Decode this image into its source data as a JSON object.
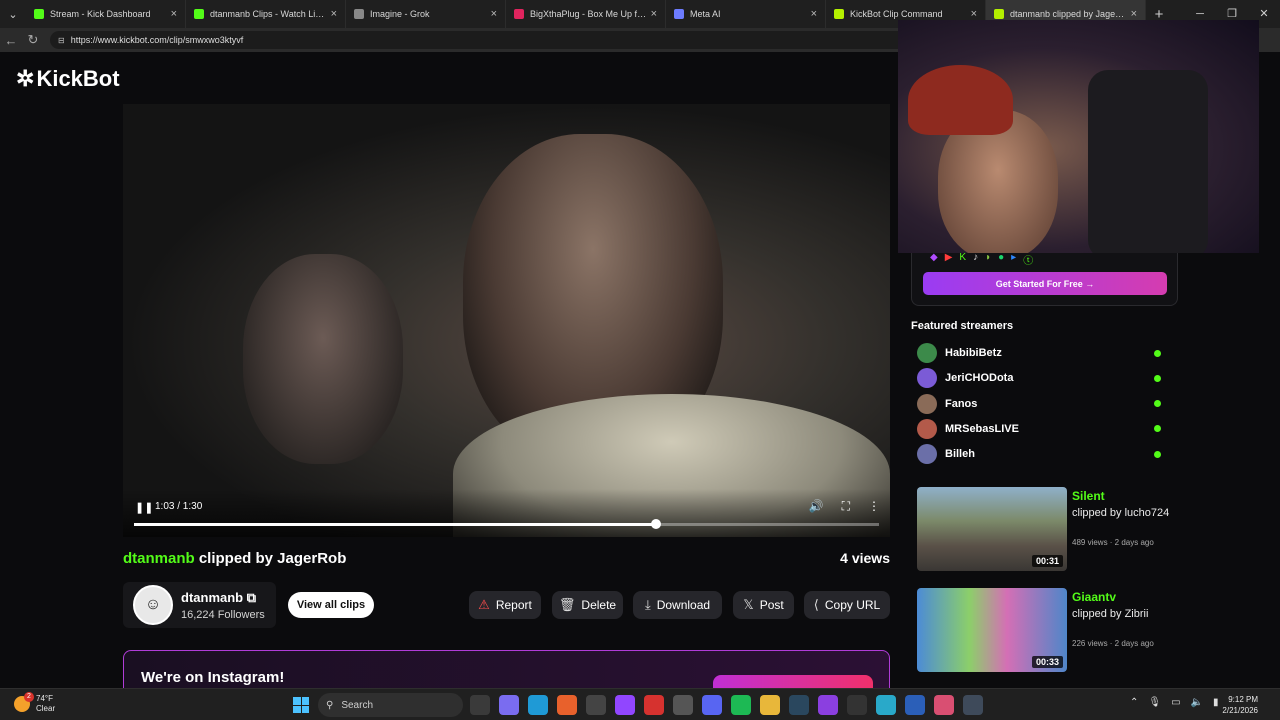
{
  "browser": {
    "tabs": [
      {
        "title": "Stream - Kick Dashboard",
        "color": "#53fc18",
        "active": false
      },
      {
        "title": "dtanmanb Clips - Watch Live on K",
        "color": "#53fc18",
        "active": false
      },
      {
        "title": "Imagine - Grok",
        "color": "#888888",
        "active": false
      },
      {
        "title": "BigXthaPlug - Box Me Up feat. Jel",
        "color": "#e0245e",
        "active": false
      },
      {
        "title": "Meta AI",
        "color": "#6d7cff",
        "active": false
      },
      {
        "title": "KickBot Clip Command",
        "color": "#b4f000",
        "active": false
      },
      {
        "title": "dtanmanb clipped by JagerRo",
        "color": "#b4f000",
        "active": true
      }
    ],
    "url": "https://www.kickbot.com/clip/smwxwo3ktyvf"
  },
  "site": {
    "logo_text": "KickBot"
  },
  "player": {
    "time": "1:03 / 1:30",
    "progress": 0.7
  },
  "clip": {
    "streamer": "dtanmanb",
    "title_rest": " clipped by JagerRob",
    "views": "4 views"
  },
  "channel": {
    "name": "dtanmanb",
    "followers": "16,224 Followers",
    "view_all": "View all clips"
  },
  "actions": {
    "report": "Report",
    "delete": "Delete",
    "download": "Download",
    "post": "Post",
    "copy_url": "Copy URL"
  },
  "instagram": {
    "text": "We're on Instagram!"
  },
  "promo": {
    "cta": "Get Started For Free →"
  },
  "featured": {
    "heading": "Featured streamers",
    "streamers": [
      {
        "name": "HabibiBetz",
        "color": "#3c8a4a"
      },
      {
        "name": "JeriCHODota",
        "color": "#7b5bd6"
      },
      {
        "name": "Fanos",
        "color": "#8a6b58"
      },
      {
        "name": "MRSebasLIVE",
        "color": "#b35a4a"
      },
      {
        "name": "Billeh",
        "color": "#6b6fa8"
      }
    ]
  },
  "related_clips": [
    {
      "title": "Silent",
      "by": "clipped by lucho724",
      "meta": "489 views · 2 days ago",
      "duration": "00:31"
    },
    {
      "title": "Giaantv",
      "by": "clipped by Zibrii",
      "meta": "226 views · 2 days ago",
      "duration": "00:33"
    }
  ],
  "taskbar": {
    "temp": "74°F",
    "condition": "Clear",
    "weather_badge": "2",
    "search_placeholder": "Search",
    "time": "9:12 PM",
    "date": "2/21/2026"
  }
}
